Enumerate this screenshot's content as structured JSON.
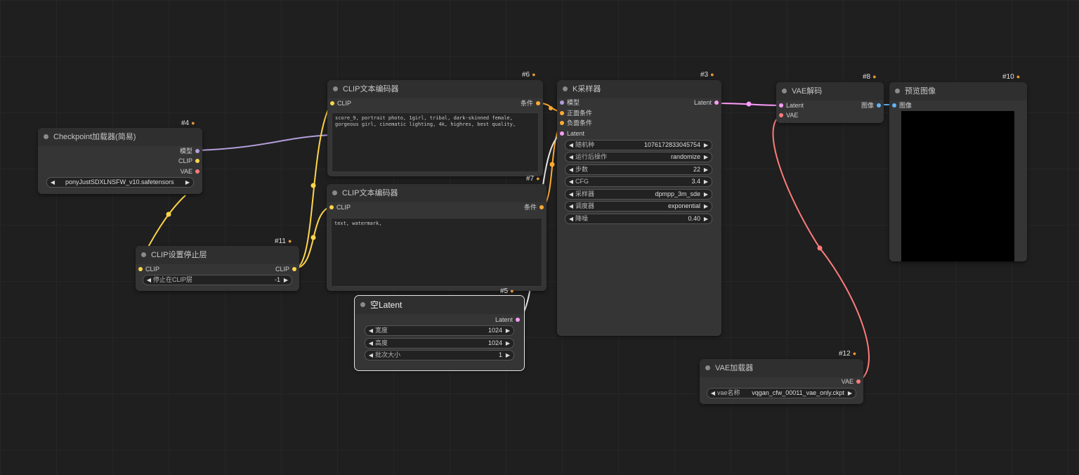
{
  "colors": {
    "model": "#b39ddb",
    "clip": "#ffd54a",
    "vae": "#ff7b7b",
    "conditioning": "#ffa931",
    "latent": "#ff9cf9",
    "image": "#64b5f6"
  },
  "nodes": {
    "checkpoint": {
      "title": "Checkpoint加载器(简易)",
      "id": "#4",
      "out_model": "模型",
      "out_clip": "CLIP",
      "out_vae": "VAE",
      "ckpt_value": "ponyJustSDXLNSFW_v10.safetensors"
    },
    "clip_stop": {
      "title": "CLIP设置停止层",
      "id": "#11",
      "in_clip": "CLIP",
      "out_clip": "CLIP",
      "stop_label": "停止在CLIP层",
      "stop_value": "-1"
    },
    "clip_pos": {
      "title": "CLIP文本编码器",
      "id": "#6",
      "in_clip": "CLIP",
      "out_cond": "条件",
      "text": "score_9, portrait photo, 1girl, tribal, dark-skinned female,  gorgeous girl, cinematic lighting, 4k, highres, best quality,"
    },
    "clip_neg": {
      "title": "CLIP文本编码器",
      "id": "#7",
      "in_clip": "CLIP",
      "out_cond": "条件",
      "text": "text, watermark,"
    },
    "empty_latent": {
      "title": "空Latent",
      "id": "#5",
      "out_latent": "Latent",
      "widgets": [
        {
          "label": "宽度",
          "value": "1024"
        },
        {
          "label": "高度",
          "value": "1024"
        },
        {
          "label": "批次大小",
          "value": "1"
        }
      ]
    },
    "ksampler": {
      "title": "K采样器",
      "id": "#3",
      "in_model": "模型",
      "in_pos": "正面条件",
      "in_neg": "负面条件",
      "in_latent": "Latent",
      "out_latent": "Latent",
      "widgets": [
        {
          "label": "随机种",
          "value": "1076172833045754"
        },
        {
          "label": "运行后操作",
          "value": "randomize"
        },
        {
          "label": "步数",
          "value": "22"
        },
        {
          "label": "CFG",
          "value": "3.4"
        },
        {
          "label": "采样器",
          "value": "dpmpp_3m_sde"
        },
        {
          "label": "调度器",
          "value": "exponential"
        },
        {
          "label": "降噪",
          "value": "0.40"
        }
      ]
    },
    "vae_decode": {
      "title": "VAE解码",
      "id": "#8",
      "in_latent": "Latent",
      "in_vae": "VAE",
      "out_image": "图像"
    },
    "preview": {
      "title": "预览图像",
      "id": "#10",
      "in_image": "图像"
    },
    "vae_loader": {
      "title": "VAE加载器",
      "id": "#12",
      "out_vae": "VAE",
      "vae_label": "vae名称",
      "vae_value": "vqgan_cfw_00011_vae_only.ckpt"
    }
  }
}
